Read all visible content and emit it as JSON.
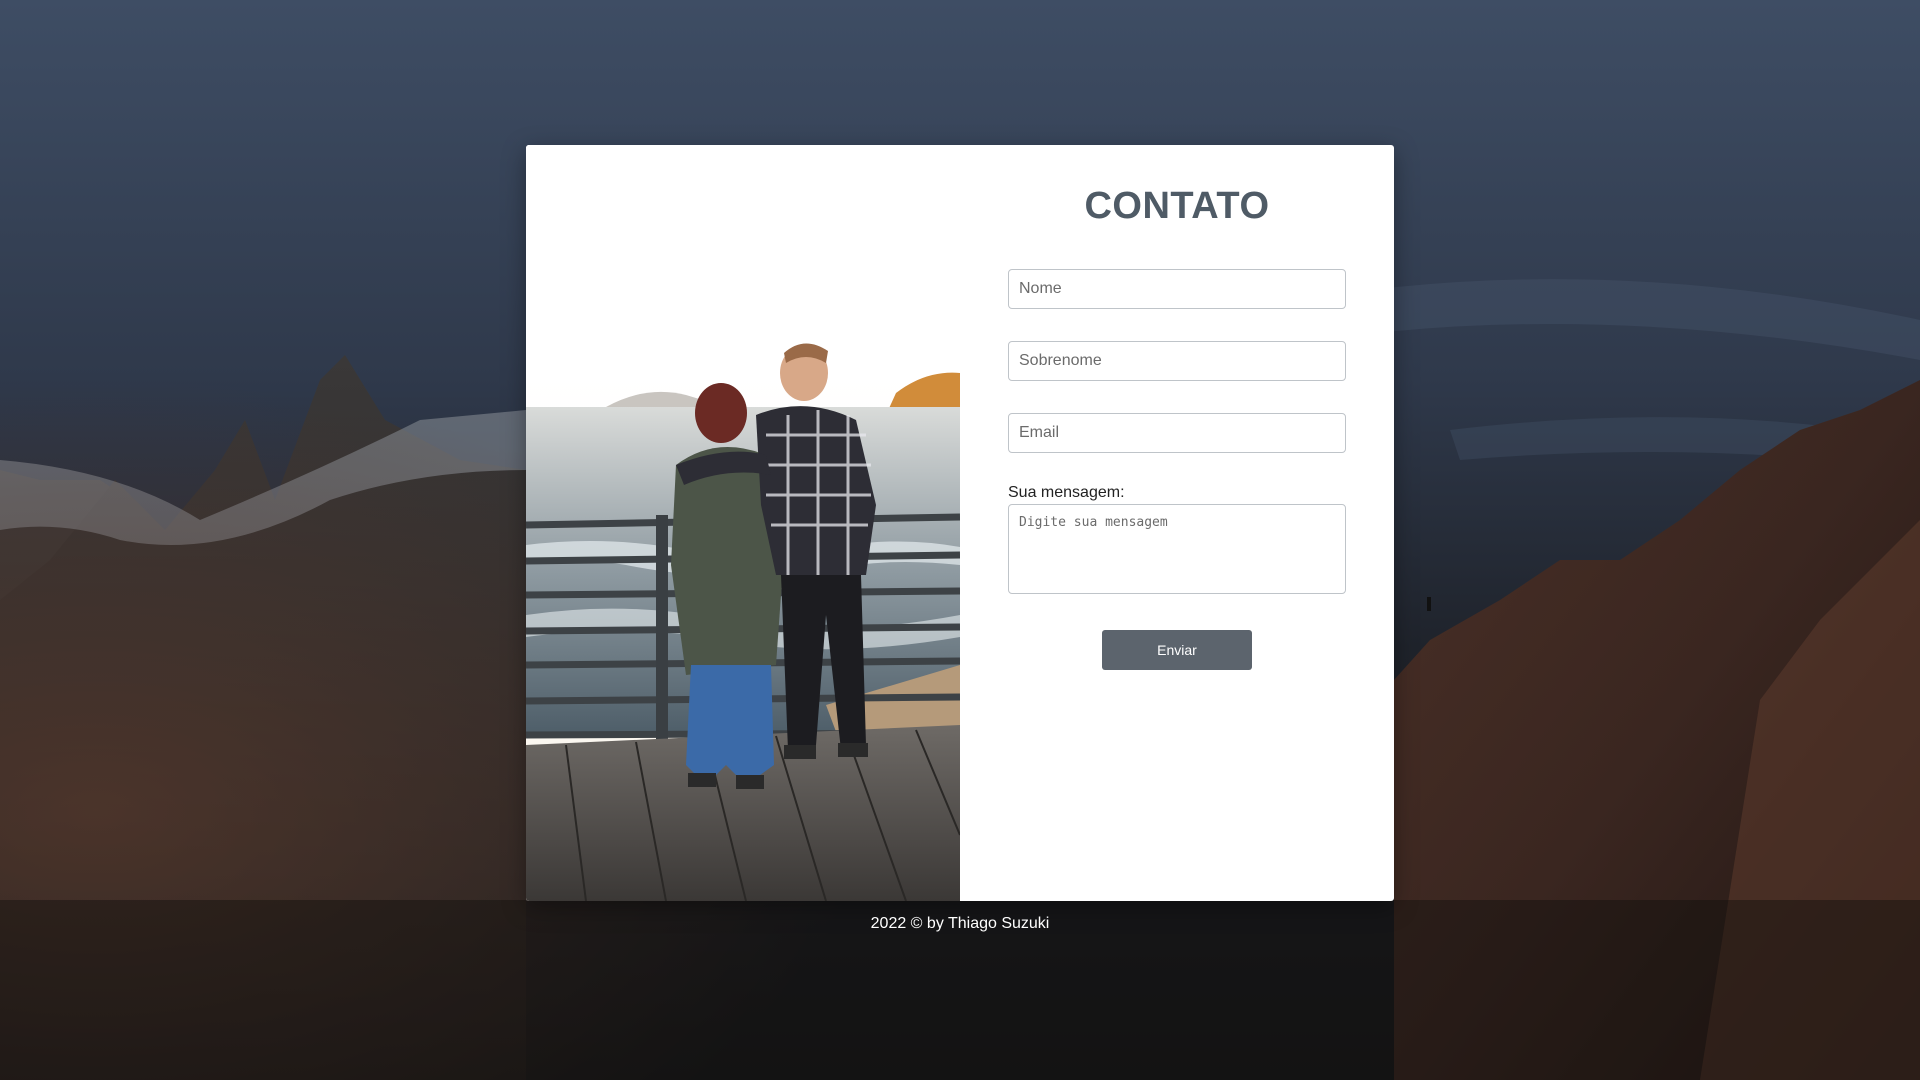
{
  "contact_form": {
    "title": "CONTATO",
    "first_name_placeholder": "Nome",
    "last_name_placeholder": "Sobrenome",
    "email_placeholder": "Email",
    "message_label": "Sua mensagem:",
    "message_placeholder": "Digite sua mensagem",
    "submit_label": "Enviar"
  },
  "footer": {
    "text": "2022 © by Thiago Suzuki"
  },
  "colors": {
    "title": "#4f5b66",
    "button": "#5c646d",
    "card": "#ffffff"
  }
}
